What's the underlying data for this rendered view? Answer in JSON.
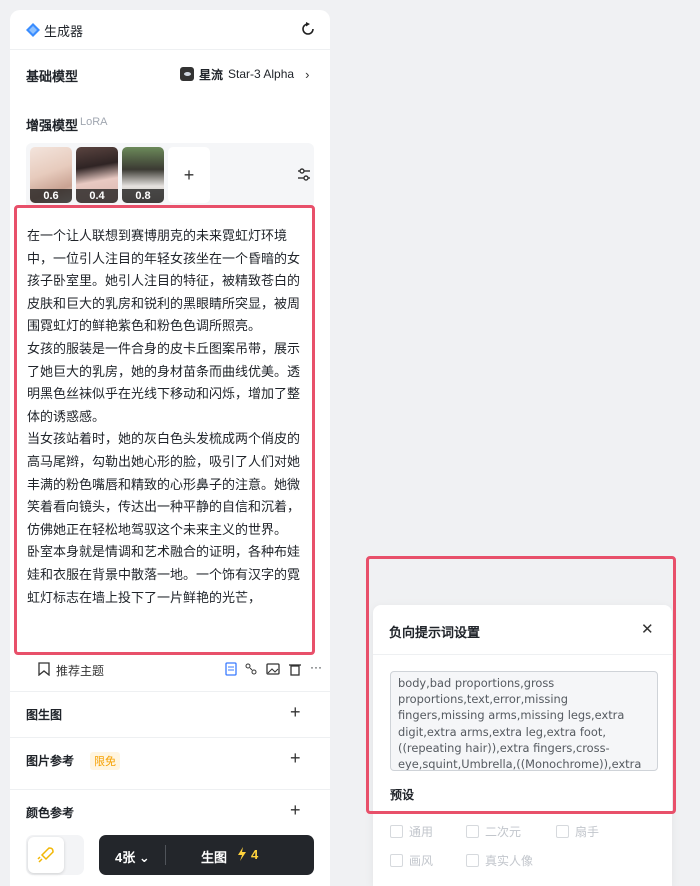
{
  "header": {
    "title": "生成器",
    "logo_icon": "diamond-logo-icon",
    "reset_icon": "refresh-icon"
  },
  "base_model": {
    "label": "基础模型",
    "name_cn": "星流",
    "name_en": "Star-3 Alpha"
  },
  "lora": {
    "label": "增强模型",
    "tag": "LoRA",
    "items": [
      {
        "weight": "0.6"
      },
      {
        "weight": "0.4"
      },
      {
        "weight": "0.8"
      }
    ],
    "add_label": "+"
  },
  "prompt": {
    "text": "在一个让人联想到赛博朋克的未来霓虹灯环境中，一位引人注目的年轻女孩坐在一个昏暗的女孩子卧室里。她引人注目的特征，被精致苍白的皮肤和巨大的乳房和锐利的黑眼睛所突显，被周围霓虹灯的鲜艳紫色和粉色色调所照亮。\n女孩的服装是一件合身的皮卡丘图案吊带，展示了她巨大的乳房，她的身材苗条而曲线优美。透明黑色丝袜似乎在光线下移动和闪烁，增加了整体的诱惑感。\n当女孩站着时，她的灰白色头发梳成两个俏皮的高马尾辫，勾勒出她心形的脸，吸引了人们对她丰满的粉色嘴唇和精致的心形鼻子的注意。她微笑着看向镜头，传达出一种平静的自信和沉着，仿佛她正在轻松地驾驭这个未来主义的世界。\n卧室本身就是情调和艺术融合的证明，各种布娃娃和衣服在背景中散落一地。一个饰有汉字的霓虹灯标志在墙上投下了一片鲜艳的光芒，"
  },
  "toolbar": {
    "recommend_label": "推荐主题"
  },
  "sections": {
    "img2img": "图生图",
    "img_ref": "图片参考",
    "free_badge": "限免",
    "color_ref": "颜色参考"
  },
  "generate": {
    "count": "4张",
    "label": "生图",
    "cost": "4"
  },
  "negative_modal": {
    "title": "负向提示词设置",
    "text": "body,bad proportions,gross proportions,text,error,missing fingers,missing arms,missing legs,extra digit,extra arms,extra leg,extra foot,((repeating hair)),extra fingers,cross-eye,squint,Umbrella,((Monochrome)),extra digit,fewer digits,",
    "preset_label": "预设",
    "presets": [
      "通用",
      "二次元",
      "扇手",
      "画风",
      "真实人像"
    ]
  },
  "colors": {
    "accent_outline": "#e8506a",
    "generate_bg": "#23262b",
    "cost_color": "#ffd23c",
    "badge_color": "#f5a000"
  }
}
